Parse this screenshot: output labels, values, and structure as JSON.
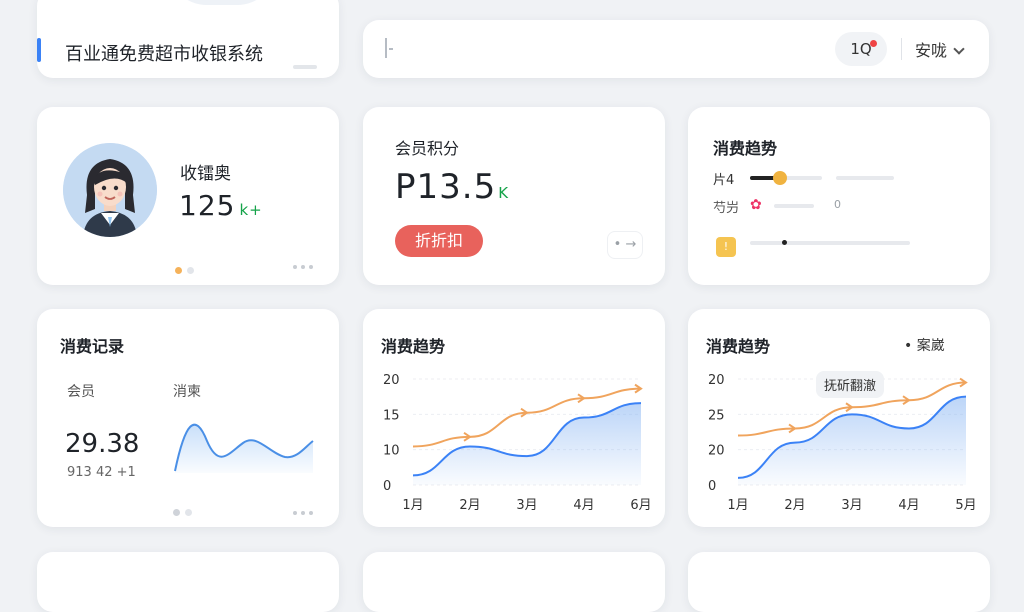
{
  "header": {
    "app_name": "百业通免费超市收银系统",
    "search": {
      "cursor_glyph": "|"
    },
    "notifications": {
      "label": "1Q",
      "has_unread": true
    },
    "language": {
      "label": "安咙"
    }
  },
  "member_card": {
    "label": "收镭奥",
    "value": "125",
    "suffix": "k+"
  },
  "points_card": {
    "label": "会员积分",
    "value": "P13.5",
    "suffix": "K",
    "button_label": "折折扣",
    "arrow_label": "• →"
  },
  "trend_mini": {
    "title": "消费趋势",
    "rows": [
      {
        "label": "片4",
        "level": 0.42
      },
      {
        "label": "芍屶",
        "value": "0"
      },
      {
        "badge": "!"
      }
    ]
  },
  "records_card": {
    "title": "消费记录",
    "col_a": "会员",
    "col_b": "消柬",
    "big_value": "29.38",
    "sub_value": "913 42 +1"
  },
  "trend_card_2": {
    "title": "消费趋势",
    "chart_data": {
      "type": "line",
      "categories": [
        "1月",
        "2月",
        "3月",
        "4月",
        "6月"
      ],
      "y_ticks": [
        0,
        10,
        15,
        20
      ],
      "ylim": [
        0,
        22
      ],
      "series": [
        {
          "color": "#3b82f6",
          "values": [
            2,
            8,
            6,
            14,
            17
          ],
          "area": true
        },
        {
          "color": "#f0a45d",
          "values": [
            8,
            10,
            15,
            18,
            20
          ],
          "markers": "arrow"
        }
      ]
    }
  },
  "trend_card_3": {
    "title": "消费趋势",
    "legend": "• 案崴",
    "tooltip": "抚斫翻澈",
    "chart_data": {
      "type": "line",
      "categories": [
        "1月",
        "2月",
        "3月",
        "4月",
        "5月"
      ],
      "y_ticks": [
        "0",
        "20",
        "25",
        "20"
      ],
      "ylim": [
        0,
        30
      ],
      "series": [
        {
          "color": "#3b82f6",
          "values": [
            2,
            12,
            20,
            16,
            25
          ],
          "area": true
        },
        {
          "color": "#f0a45d",
          "values": [
            14,
            16,
            22,
            24,
            29
          ],
          "markers": "arrow"
        }
      ]
    }
  }
}
